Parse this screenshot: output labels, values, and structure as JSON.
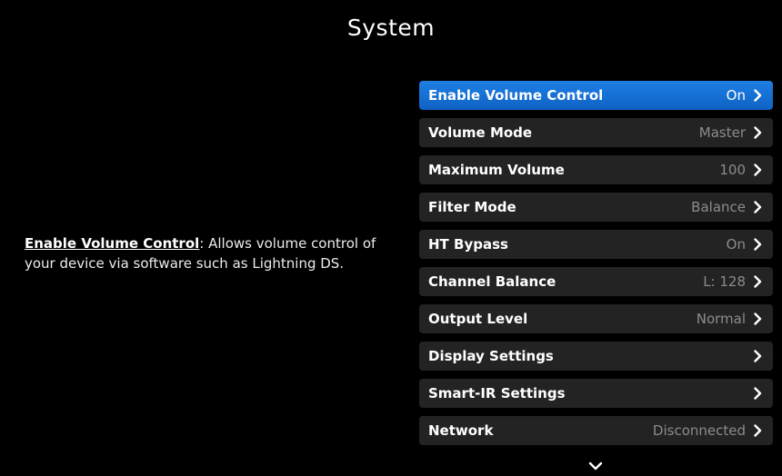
{
  "header": {
    "title": "System"
  },
  "help": {
    "term": "Enable Volume Control",
    "description": ": Allows volume control of your device via software such as Lightning DS."
  },
  "menu": {
    "items": [
      {
        "label": "Enable Volume Control",
        "value": "On",
        "selected": true
      },
      {
        "label": "Volume Mode",
        "value": "Master"
      },
      {
        "label": "Maximum Volume",
        "value": "100"
      },
      {
        "label": "Filter Mode",
        "value": "Balance"
      },
      {
        "label": "HT Bypass",
        "value": "On"
      },
      {
        "label": "Channel Balance",
        "value": "L: 128"
      },
      {
        "label": "Output Level",
        "value": "Normal"
      },
      {
        "label": "Display Settings",
        "value": ""
      },
      {
        "label": "Smart-IR Settings",
        "value": ""
      },
      {
        "label": "Network",
        "value": "Disconnected"
      }
    ]
  },
  "icons": {
    "item_arrow": "chevron-right-icon",
    "scroll_more": "chevron-down-icon"
  },
  "colors": {
    "background": "#000000",
    "row": "#232323",
    "selected_row": "#1470d6",
    "value_text": "#8c8c8c"
  }
}
